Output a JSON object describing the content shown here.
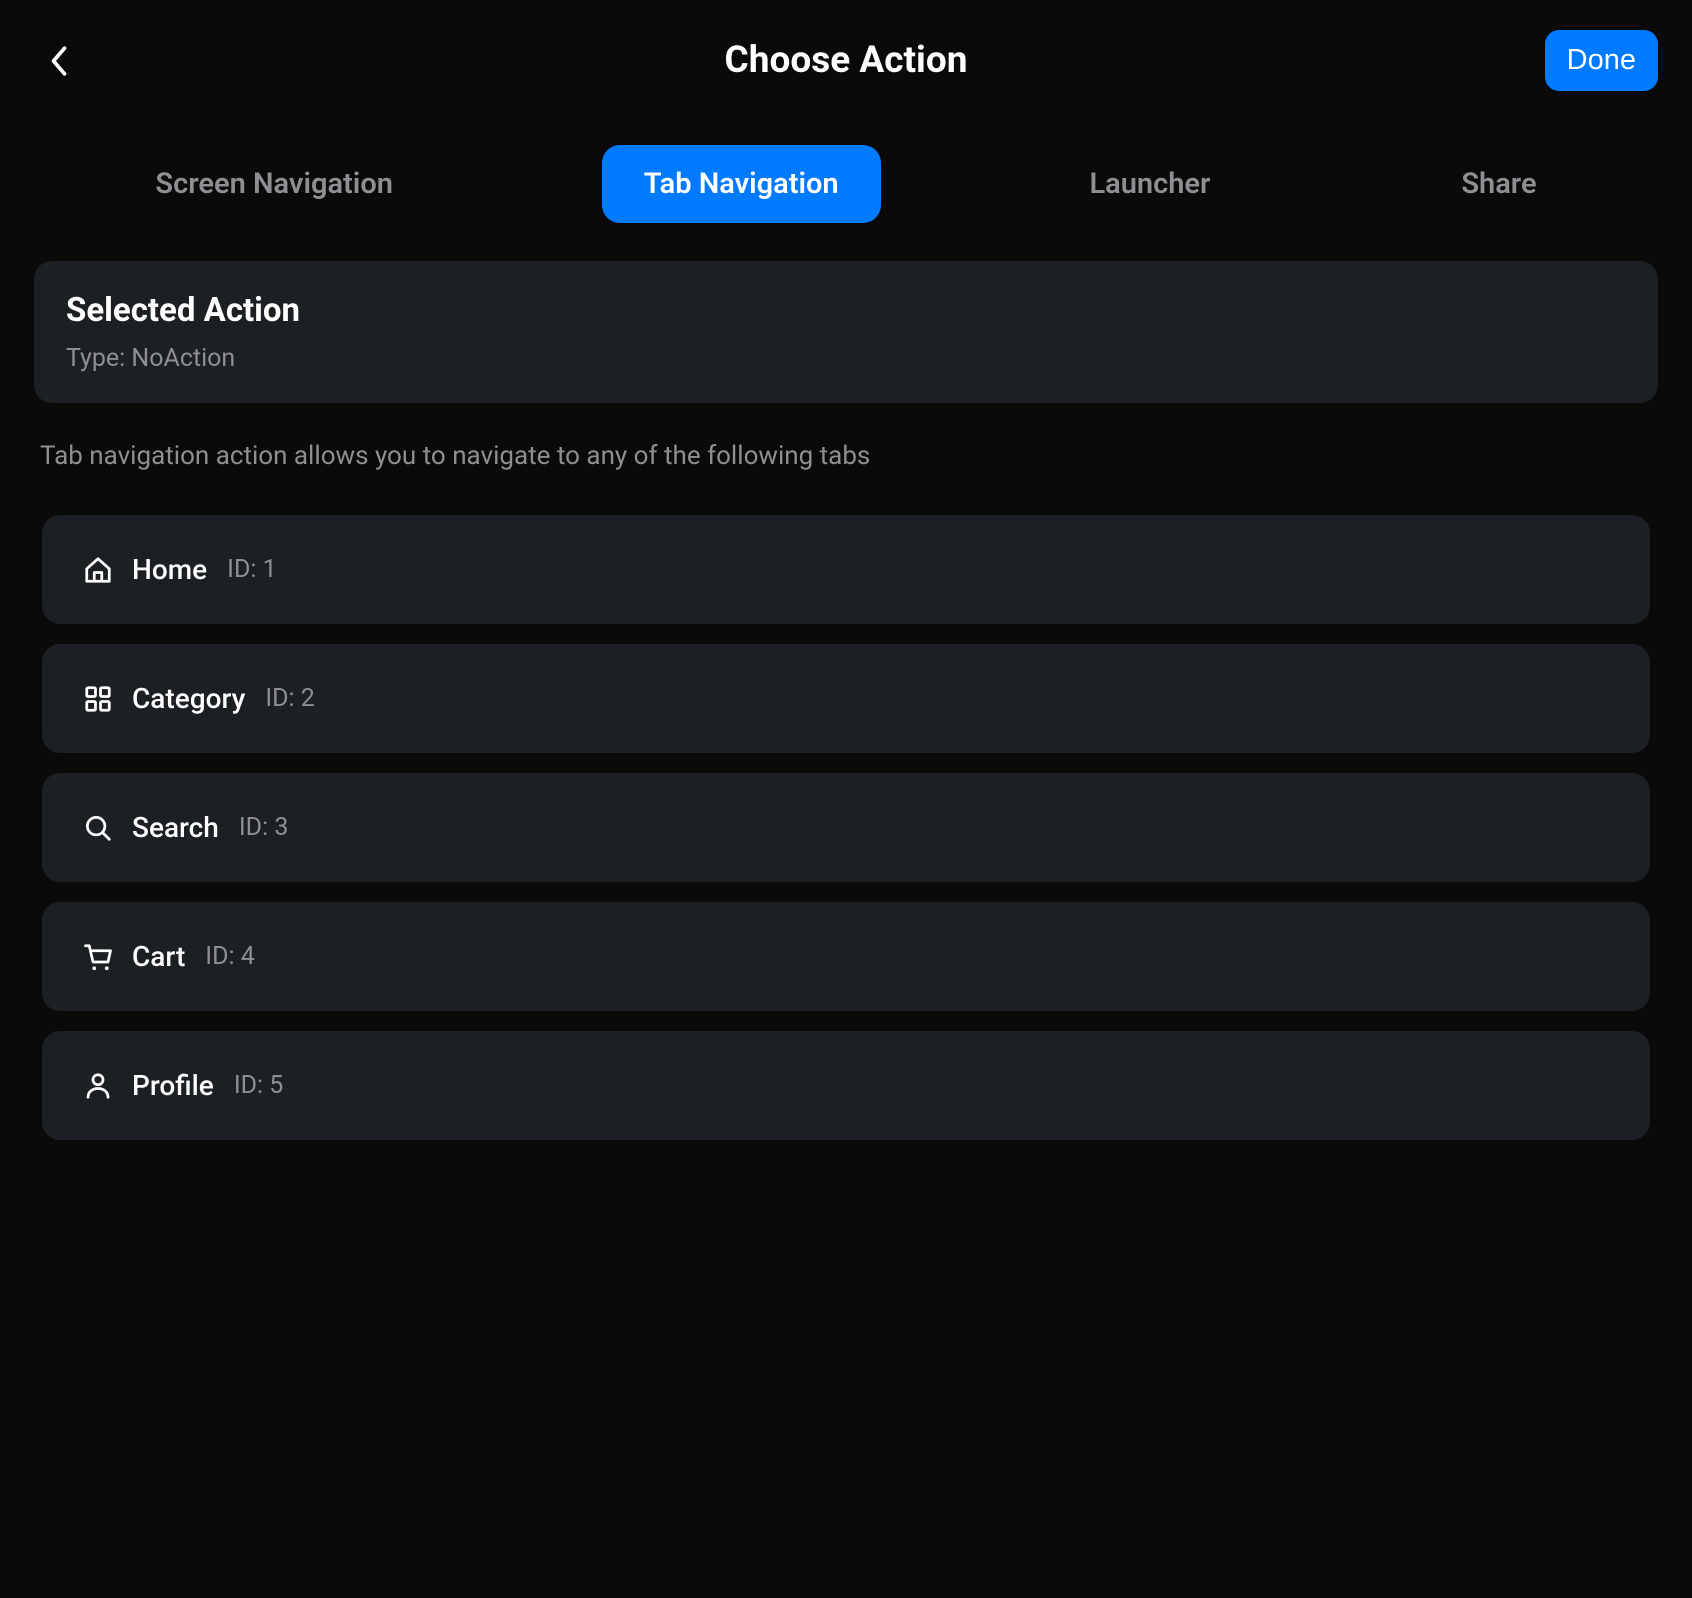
{
  "header": {
    "title": "Choose Action",
    "done_label": "Done"
  },
  "tabs": [
    {
      "label": "Screen Navigation",
      "active": false
    },
    {
      "label": "Tab Navigation",
      "active": true
    },
    {
      "label": "Launcher",
      "active": false
    },
    {
      "label": "Share",
      "active": false
    }
  ],
  "selected_action": {
    "title": "Selected Action",
    "type_label": "Type: NoAction"
  },
  "description": "Tab navigation action allows you to navigate to any of the following tabs",
  "items": [
    {
      "icon": "home",
      "label": "Home",
      "id_label": "ID: 1"
    },
    {
      "icon": "category",
      "label": "Category",
      "id_label": "ID: 2"
    },
    {
      "icon": "search",
      "label": "Search",
      "id_label": "ID: 3"
    },
    {
      "icon": "cart",
      "label": "Cart",
      "id_label": "ID: 4"
    },
    {
      "icon": "profile",
      "label": "Profile",
      "id_label": "ID: 5"
    }
  ]
}
